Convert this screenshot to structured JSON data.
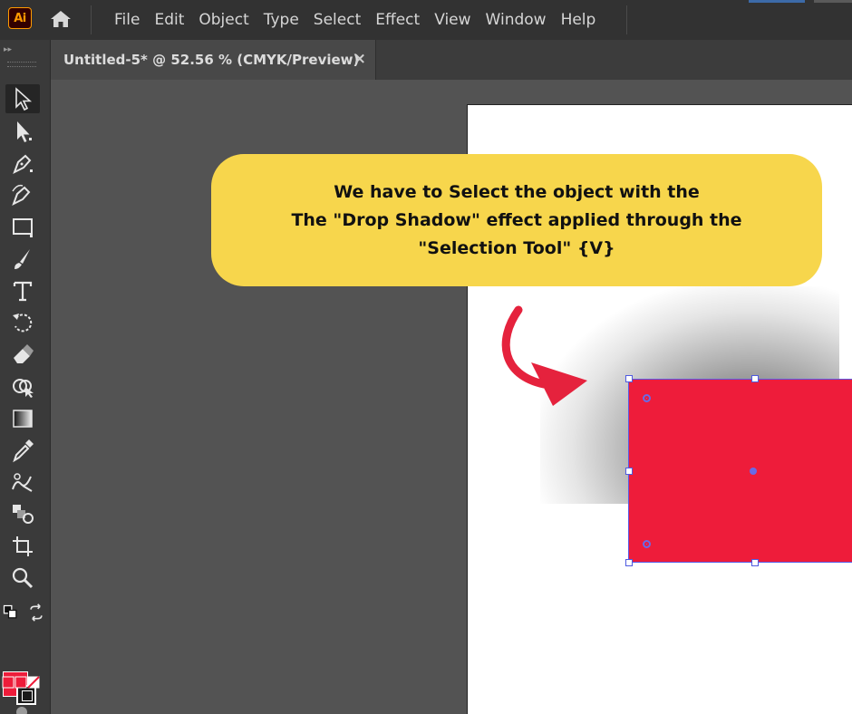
{
  "app": {
    "logo_text": "Ai",
    "logo_colors": {
      "bg": "#330000",
      "fg": "#ff9a00"
    }
  },
  "menu": {
    "items": [
      "File",
      "Edit",
      "Object",
      "Type",
      "Select",
      "Effect",
      "View",
      "Window",
      "Help"
    ]
  },
  "document_tab": {
    "title": "Untitled-5* @ 52.56 % (CMYK/Preview)",
    "close_glyph": "×"
  },
  "tools": [
    "selection-tool-icon",
    "direct-selection-tool-icon",
    "pen-tool-icon",
    "curvature-tool-icon",
    "rectangle-tool-icon",
    "paintbrush-tool-icon",
    "type-tool-icon",
    "rotate-tool-icon",
    "eraser-tool-icon",
    "shape-builder-tool-icon",
    "gradient-tool-icon",
    "eyedropper-tool-icon",
    "puppet-warp-tool-icon",
    "symbol-sprayer-tool-icon",
    "artboard-tool-icon",
    "zoom-tool-icon"
  ],
  "colors": {
    "fill": "#ee1c3a",
    "stroke": "#1a1a1a",
    "selection": "#4f5be0",
    "callout": "#f7d64c",
    "arrow": "#e5223d"
  },
  "callout": {
    "lines": [
      "We have to Select the object with the",
      "The \"Drop Shadow\" effect applied through the",
      "\"Selection Tool\" {V}"
    ]
  }
}
